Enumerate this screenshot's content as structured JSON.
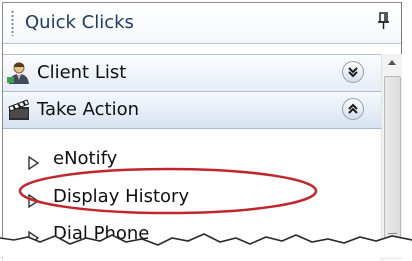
{
  "panel": {
    "title": "Quick Clicks",
    "pin_glyph": "\u0004"
  },
  "sections": [
    {
      "label": "Client List",
      "icon": "person-icon",
      "chevron": "expand-down-icon"
    },
    {
      "label": "Take Action",
      "icon": "clapperboard-icon",
      "chevron": "collapse-up-icon"
    }
  ],
  "actions": [
    {
      "label": "eNotify"
    },
    {
      "label": "Display History"
    },
    {
      "label": "Dial Phone"
    }
  ],
  "colors": {
    "title_text": "#1e3b66",
    "section_gradient_top": "#fbfcfe",
    "section_gradient_bottom": "#e5edf7",
    "highlight_ellipse": "#c0262c"
  }
}
